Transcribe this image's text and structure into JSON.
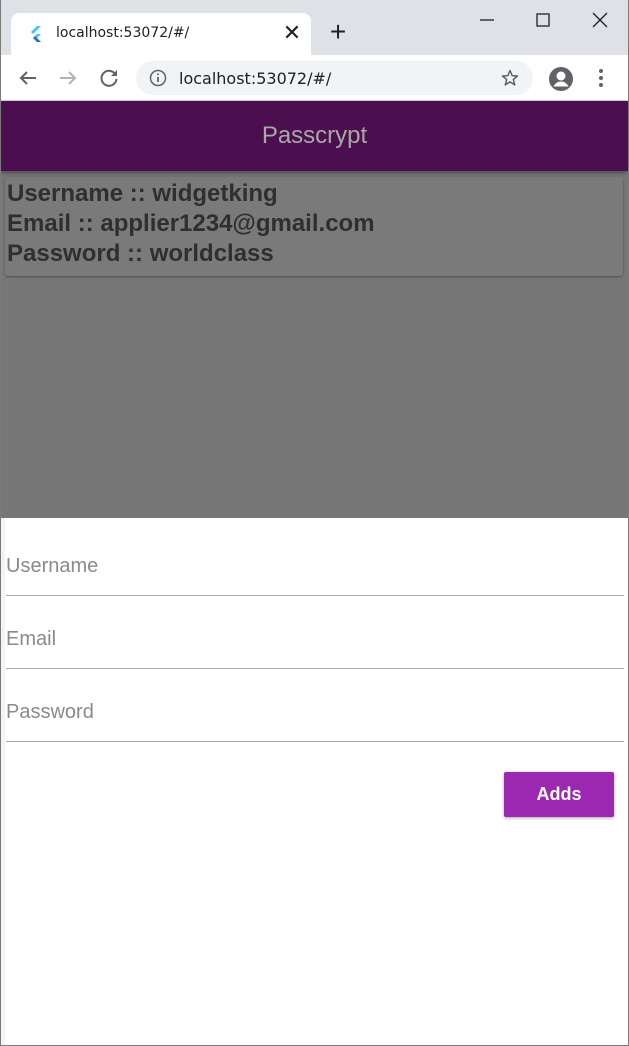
{
  "browser": {
    "tab_title": "localhost:53072/#/",
    "tab_close_glyph": "✕",
    "new_tab_glyph": "+",
    "url": "localhost:53072/#/",
    "icons": [
      "flutter-favicon",
      "back-arrow-icon",
      "forward-arrow-icon",
      "reload-icon",
      "info-icon",
      "star-icon",
      "profile-icon",
      "menu-icon",
      "minimize-icon",
      "maximize-icon",
      "close-window-icon"
    ]
  },
  "app": {
    "title": "Passcrypt",
    "colors": {
      "app_bar": "#4b0f4f",
      "title_text": "#a8a8a8",
      "list_background": "#777777",
      "button": "#9c27b0"
    },
    "entries": [
      {
        "username_line": "Username :: widgetking",
        "email_line": "Email :: applier1234@gmail.com",
        "password_line": "Password :: worldclass"
      }
    ],
    "form": {
      "username_placeholder": "Username",
      "email_placeholder": "Email",
      "password_placeholder": "Password",
      "submit_label": "Adds"
    }
  }
}
